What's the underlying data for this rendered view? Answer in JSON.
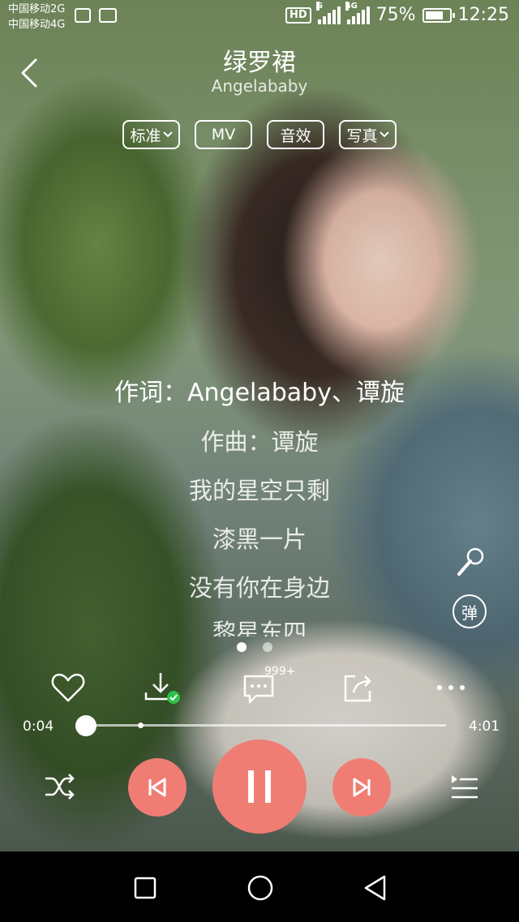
{
  "status_bar": {
    "carrier_1": "中国移动2G",
    "carrier_2": "中国移动4G",
    "hd": "HD",
    "signal_1_tag": "G",
    "signal_2_tag": "4G",
    "battery_percent": "75%",
    "battery_level": 0.75,
    "time": "12:25"
  },
  "header": {
    "title": "绿罗裙",
    "artist": "Angelababy"
  },
  "chips": {
    "quality": "标准",
    "mv": "MV",
    "effects": "音效",
    "photos": "写真"
  },
  "lyrics": [
    "作词：Angelababy、谭旋",
    "作曲：谭旋",
    "我的星空只剩",
    "漆黑一片",
    "没有你在身边",
    "黎星东四"
  ],
  "danmu_label": "弹",
  "actions": {
    "comment_count": "999+"
  },
  "progress": {
    "current": "0:04",
    "total": "4:01",
    "fraction": 0.017
  },
  "colors": {
    "accent": "#ef7d74",
    "download_ok": "#2fbf4a"
  },
  "icons": {
    "back": "chevron-left-icon",
    "mic": "microphone-icon",
    "like": "heart-icon",
    "download": "download-icon",
    "comment": "comment-icon",
    "share": "share-icon",
    "more": "more-icon",
    "shuffle": "shuffle-icon",
    "prev": "skip-previous-icon",
    "pause": "pause-icon",
    "next": "skip-next-icon",
    "playlist": "playlist-icon"
  }
}
